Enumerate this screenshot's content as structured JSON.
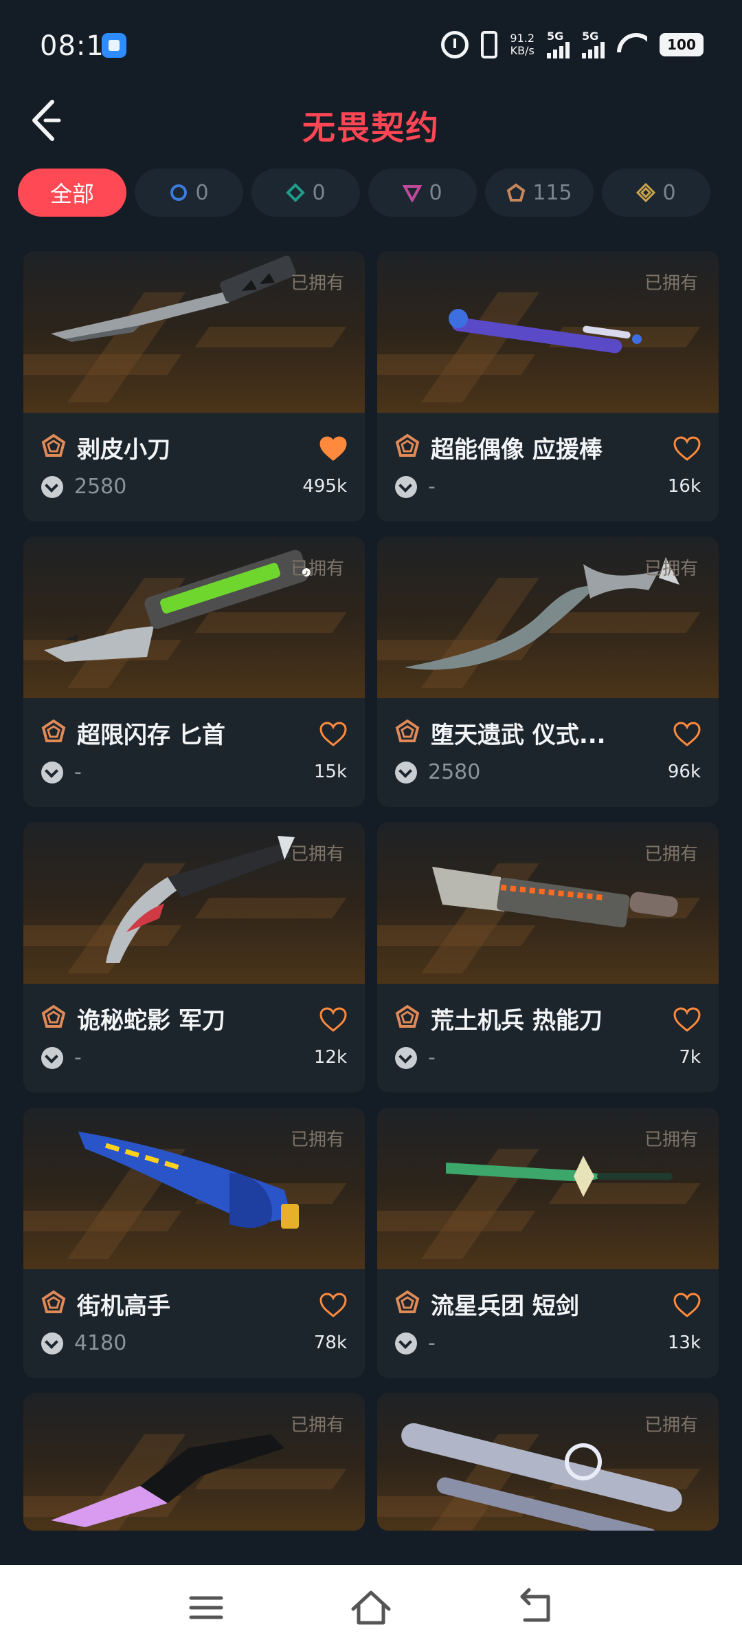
{
  "status_bar": {
    "time": "08:17",
    "net_speed": "91.2",
    "net_speed_unit": "KB/s",
    "sim1": "5G",
    "sim2": "5G",
    "battery": "100"
  },
  "header": {
    "title": "无畏契约"
  },
  "filters": [
    {
      "label": "全部",
      "active": true,
      "icon": "all",
      "color": "#ff4a55"
    },
    {
      "label": "0",
      "active": false,
      "icon": "tier-select-icon",
      "color": "#3b7bd9"
    },
    {
      "label": "0",
      "active": false,
      "icon": "tier-deluxe-icon",
      "color": "#1f9c8a"
    },
    {
      "label": "0",
      "active": false,
      "icon": "tier-premium-icon",
      "color": "#c04a9a"
    },
    {
      "label": "115",
      "active": false,
      "icon": "tier-exclusive-icon",
      "color": "#c8875a"
    },
    {
      "label": "0",
      "active": false,
      "icon": "tier-ultra-icon",
      "color": "#c9a34b"
    }
  ],
  "cards": [
    {
      "name": "剥皮小刀",
      "owned": "已拥有",
      "price": "2580",
      "likes": "495k",
      "liked": true
    },
    {
      "name": "超能偶像 应援棒",
      "owned": "已拥有",
      "price": "-",
      "likes": "16k",
      "liked": false
    },
    {
      "name": "超限闪存 匕首",
      "owned": "已拥有",
      "price": "-",
      "likes": "15k",
      "liked": false
    },
    {
      "name": "堕天遗武 仪式...",
      "owned": "已拥有",
      "price": "2580",
      "likes": "96k",
      "liked": false
    },
    {
      "name": "诡秘蛇影 军刀",
      "owned": "已拥有",
      "price": "-",
      "likes": "12k",
      "liked": false
    },
    {
      "name": "荒土机兵 热能刀",
      "owned": "已拥有",
      "price": "-",
      "likes": "7k",
      "liked": false
    },
    {
      "name": "街机高手",
      "owned": "已拥有",
      "price": "4180",
      "likes": "78k",
      "liked": false
    },
    {
      "name": "流星兵团 短剑",
      "owned": "已拥有",
      "price": "-",
      "likes": "13k",
      "liked": false
    },
    {
      "owned": "已拥有"
    },
    {
      "owned": "已拥有"
    }
  ],
  "colors": {
    "accent": "#ff4a55",
    "tier_badge": "#e08a57",
    "heart_liked": "#ff8a3d",
    "heart_outline": "#ff8a3d"
  }
}
